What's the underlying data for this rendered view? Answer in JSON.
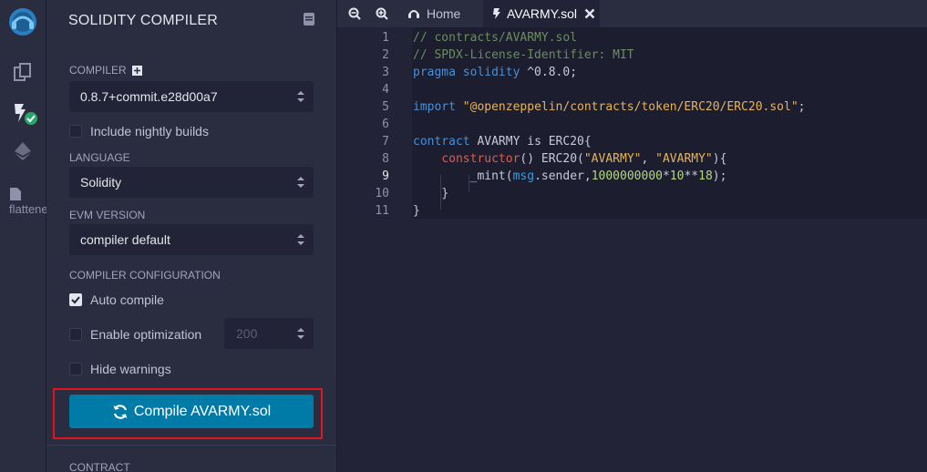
{
  "iconbar": {
    "items": [
      "home-logo-icon",
      "file-explorer-icon",
      "solidity-compiler-icon",
      "deploy-run-icon",
      "flattener-icon"
    ],
    "flattener_label": "flattene"
  },
  "sidebar": {
    "title": "SOLIDITY COMPILER",
    "compiler_label": "COMPILER",
    "compiler_value": "0.8.7+commit.e28d00a7",
    "nightly_label": "Include nightly builds",
    "language_label": "LANGUAGE",
    "language_value": "Solidity",
    "evm_label": "EVM VERSION",
    "evm_value": "compiler default",
    "config_label": "COMPILER CONFIGURATION",
    "auto_compile_label": "Auto compile",
    "optimization_label": "Enable optimization",
    "optimization_runs": "200",
    "hide_warnings_label": "Hide warnings",
    "compile_button": "Compile AVARMY.sol",
    "contract_label": "CONTRACT"
  },
  "tabs": {
    "home_label": "Home",
    "file_label": "AVARMY.sol"
  },
  "editor": {
    "line_numbers": [
      "1",
      "2",
      "3",
      "4",
      "5",
      "6",
      "7",
      "8",
      "9",
      "10",
      "11"
    ],
    "lines": {
      "l1": "// contracts/AVARMY.sol",
      "l2": "// SPDX-License-Identifier: MIT",
      "l3_kw": "pragma solidity",
      "l3_rest": " ^0.8.0;",
      "l5_kw": "import",
      "l5_str": "\"@openzeppelin/contracts/token/ERC20/ERC20.sol\"",
      "l5_end": ";",
      "l7_kw": "contract",
      "l7_rest": " AVARMY is ERC20{",
      "l8_fn": "constructor",
      "l8_a": "() ERC20(",
      "l8_s1": "\"AVARMY\"",
      "l8_b": ", ",
      "l8_s2": "\"AVARMY\"",
      "l8_c": "){",
      "l9_a": "_mint(",
      "l9_msg": "msg",
      "l9_b": ".sender,",
      "l9_n1": "1000000000",
      "l9_c": "*",
      "l9_n2": "10",
      "l9_d": "**",
      "l9_n3": "18",
      "l9_e": ");",
      "l10": "}",
      "l11": "}"
    }
  },
  "colors": {
    "accent": "#007aa6",
    "highlight": "#e0161c",
    "background": "#222336",
    "panel": "#2a2c3f"
  }
}
